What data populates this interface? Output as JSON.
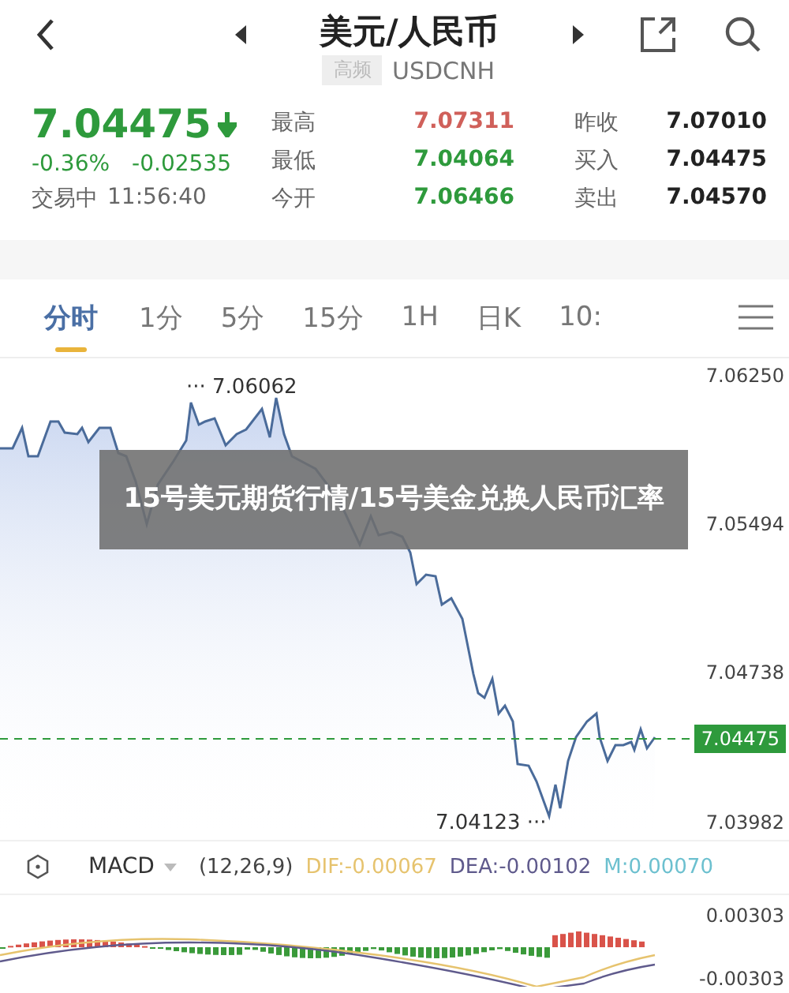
{
  "header": {
    "title": "美元/人民币",
    "tag": "高频",
    "symbol": "USDCNH"
  },
  "quote": {
    "price": "7.04475",
    "change_pct": "-0.36%",
    "change": "-0.02535",
    "status": "交易中",
    "time": "11:56:40",
    "stats": [
      {
        "label": "最高",
        "value": "7.07311",
        "color": "#d0605a"
      },
      {
        "label": "昨收",
        "value": "7.07010",
        "color": "#222222"
      },
      {
        "label": "最低",
        "value": "7.04064",
        "color": "#2e9a3c"
      },
      {
        "label": "买入",
        "value": "7.04475",
        "color": "#222222"
      },
      {
        "label": "今开",
        "value": "7.06466",
        "color": "#2e9a3c"
      },
      {
        "label": "卖出",
        "value": "7.04570",
        "color": "#222222"
      }
    ]
  },
  "tabs": [
    {
      "label": "分时",
      "selected": true
    },
    {
      "label": "1分",
      "selected": false
    },
    {
      "label": "5分",
      "selected": false
    },
    {
      "label": "15分",
      "selected": false
    },
    {
      "label": "1H",
      "selected": false
    },
    {
      "label": "日K",
      "selected": false
    },
    {
      "label": "10:",
      "selected": false
    }
  ],
  "chart": {
    "high_marker": "··· 7.06062",
    "low_marker": "7.04123 ···",
    "current": "7.04475",
    "y_labels": [
      "7.06250",
      "7.05494",
      "7.04738",
      "7.03982"
    ]
  },
  "overlay_title": "15号美元期货行情/15号美金兑换人民币汇率",
  "macd": {
    "name": "MACD",
    "params": "(12,26,9)",
    "lines": [
      {
        "text": "DIF:-0.00067",
        "color": "#e6c36e"
      },
      {
        "text": "DEA:-0.00102",
        "color": "#5f5a8c"
      },
      {
        "text": "M:0.00070",
        "color": "#6cc0cf"
      }
    ],
    "y_labels": [
      "0.00303",
      "-0.00303"
    ]
  }
}
